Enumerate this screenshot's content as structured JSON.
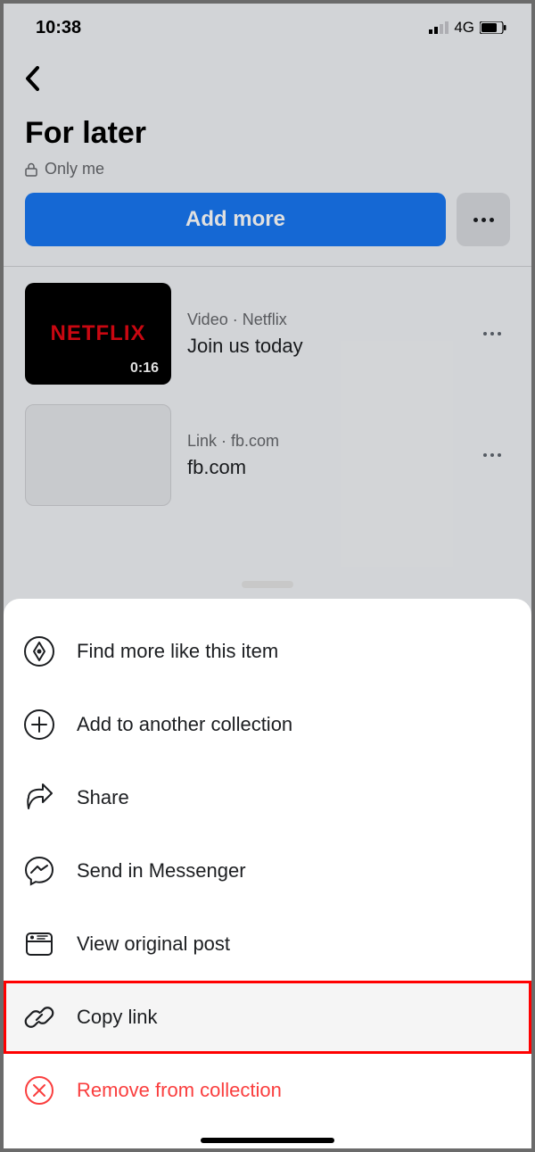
{
  "status": {
    "time": "10:38",
    "network": "4G"
  },
  "header": {
    "title": "For later",
    "privacy": "Only me"
  },
  "add_more_label": "Add more",
  "items": [
    {
      "meta": "Video · Netflix",
      "title": "Join us today",
      "duration": "0:16",
      "logo": "NETFLIX"
    },
    {
      "meta": "Link · fb.com",
      "title": "fb.com"
    }
  ],
  "sheet": {
    "find_more": "Find more like this item",
    "add_collection": "Add to another collection",
    "share": "Share",
    "messenger": "Send in Messenger",
    "view_original": "View original post",
    "copy_link": "Copy link",
    "remove": "Remove from collection"
  }
}
